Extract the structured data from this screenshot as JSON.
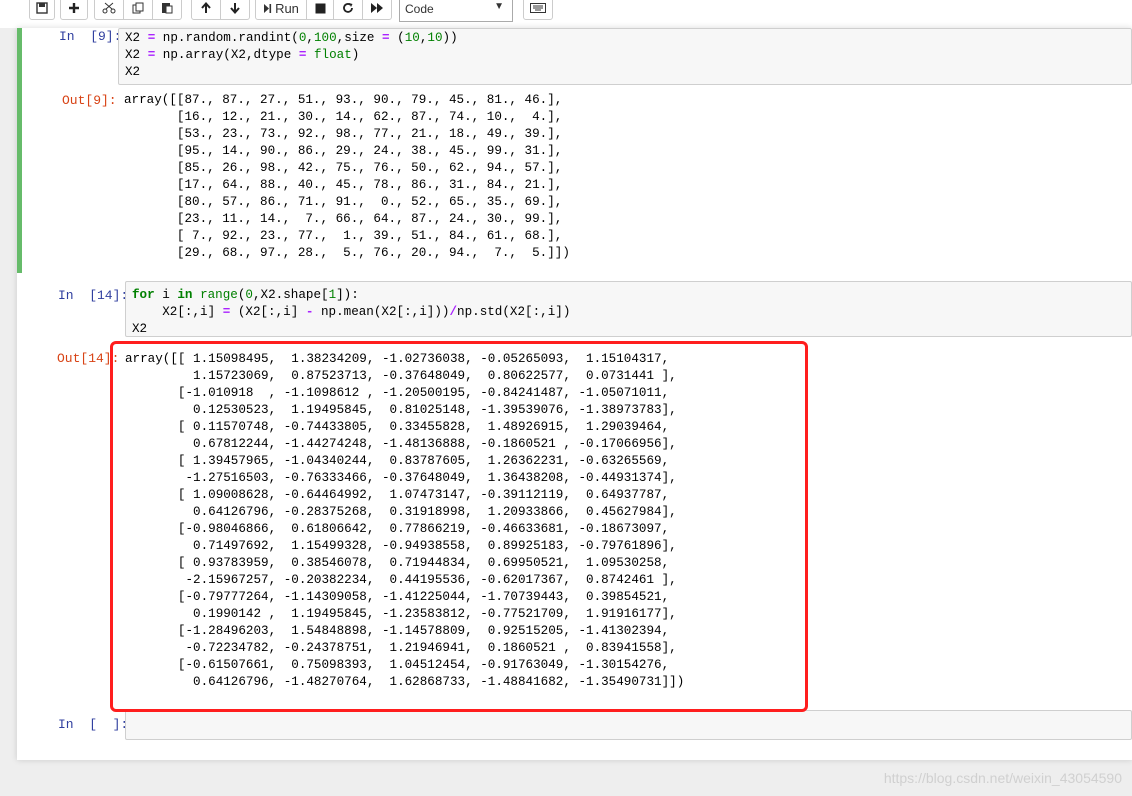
{
  "toolbar": {
    "run_label": "Run",
    "cell_type": "Code"
  },
  "cells": {
    "in9": {
      "prompt": "In  [9]:",
      "out_prompt": "Out[9]:"
    },
    "in14": {
      "prompt": "In  [14]:",
      "out_prompt": "Out[14]:"
    },
    "in_empty": {
      "prompt": "In  [  ]:"
    }
  },
  "output9": "array([[87., 87., 27., 51., 93., 90., 79., 45., 81., 46.],\n       [16., 12., 21., 30., 14., 62., 87., 74., 10.,  4.],\n       [53., 23., 73., 92., 98., 77., 21., 18., 49., 39.],\n       [95., 14., 90., 86., 29., 24., 38., 45., 99., 31.],\n       [85., 26., 98., 42., 75., 76., 50., 62., 94., 57.],\n       [17., 64., 88., 40., 45., 78., 86., 31., 84., 21.],\n       [80., 57., 86., 71., 91.,  0., 52., 65., 35., 69.],\n       [23., 11., 14.,  7., 66., 64., 87., 24., 30., 99.],\n       [ 7., 92., 23., 77.,  1., 39., 51., 84., 61., 68.],\n       [29., 68., 97., 28.,  5., 76., 20., 94.,  7.,  5.]])",
  "output14": "array([[ 1.15098495,  1.38234209, -1.02736038, -0.05265093,  1.15104317,\n         1.15723069,  0.87523713, -0.37648049,  0.80622577,  0.0731441 ],\n       [-1.010918  , -1.1098612 , -1.20500195, -0.84241487, -1.05071011,\n         0.12530523,  1.19495845,  0.81025148, -1.39539076, -1.38973783],\n       [ 0.11570748, -0.74433805,  0.33455828,  1.48926915,  1.29039464,\n         0.67812244, -1.44274248, -1.48136888, -0.1860521 , -0.17066956],\n       [ 1.39457965, -1.04340244,  0.83787605,  1.26362231, -0.63265569,\n        -1.27516503, -0.76333466, -0.37648049,  1.36438208, -0.44931374],\n       [ 1.09008628, -0.64464992,  1.07473147, -0.39112119,  0.64937787,\n         0.64126796, -0.28375268,  0.31918998,  1.20933866,  0.45627984],\n       [-0.98046866,  0.61806642,  0.77866219, -0.46633681, -0.18673097,\n         0.71497692,  1.15499328, -0.94938558,  0.89925183, -0.79761896],\n       [ 0.93783959,  0.38546078,  0.71944834,  0.69950521,  1.09530258,\n        -2.15967257, -0.20382234,  0.44195536, -0.62017367,  0.8742461 ],\n       [-0.79777264, -1.14309058, -1.41225044, -1.70739443,  0.39854521,\n         0.1990142 ,  1.19495845, -1.23583812, -0.77521709,  1.91916177],\n       [-1.28496203,  1.54848898, -1.14578809,  0.92515205, -1.41302394,\n        -0.72234782, -0.24378751,  1.21946941,  0.1860521 ,  0.83941558],\n       [-0.61507661,  0.75098393,  1.04512454, -0.91763049, -1.30154276,\n         0.64126796, -1.48270764,  1.62868733, -1.48841682, -1.35490731]])",
  "watermark": "https://blog.csdn.net/weixin_43054590",
  "colors": {
    "selected_border": "#66bb6a",
    "highlight_box": "#ff1e1e",
    "in_prompt": "#303f9f",
    "out_prompt": "#d84315"
  }
}
